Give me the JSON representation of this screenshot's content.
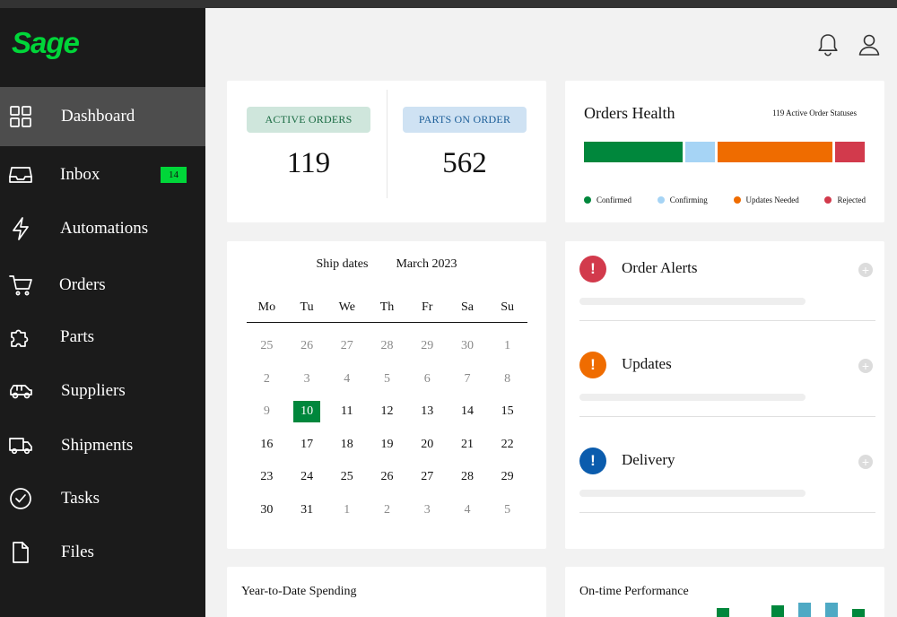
{
  "brand": {
    "name": "Sage",
    "color": "#00d639"
  },
  "nav": [
    {
      "label": "Dashboard",
      "icon": "grid-icon"
    },
    {
      "label": "Inbox",
      "icon": "inbox-icon",
      "badge": "14"
    },
    {
      "label": "Automations",
      "icon": "lightning-icon"
    },
    {
      "label": "Orders",
      "icon": "cart-icon"
    },
    {
      "label": "Parts",
      "icon": "puzzle-icon"
    },
    {
      "label": "Suppliers",
      "icon": "car-icon"
    },
    {
      "label": "Shipments",
      "icon": "truck-icon"
    },
    {
      "label": "Tasks",
      "icon": "check-circle-icon"
    },
    {
      "label": "Files",
      "icon": "file-icon"
    }
  ],
  "header": {
    "icons": [
      "bell-icon",
      "user-icon"
    ]
  },
  "stats": {
    "active_orders": {
      "label": "ACTIVE ORDERS",
      "value": "119",
      "bg": "#cfe6dc",
      "fg": "#1a6b43"
    },
    "parts_on_order": {
      "label": "PARTS ON ORDER",
      "value": "562",
      "bg": "#cfe2f3",
      "fg": "#1d5f99"
    }
  },
  "health": {
    "title": "Orders Health",
    "subtitle": "119 Active Order Statuses",
    "segments": [
      {
        "name": "Confirmed",
        "fraction": 0.355,
        "color": "#00873c"
      },
      {
        "name": "Confirming",
        "fraction": 0.108,
        "color": "#a6d4f5"
      },
      {
        "name": "Updates Needed",
        "fraction": 0.415,
        "color": "#ef6c00"
      },
      {
        "name": "Rejected",
        "fraction": 0.108,
        "color": "#d23a4c"
      }
    ]
  },
  "calendar": {
    "label": "Ship dates",
    "month": "March 2023",
    "days_of_week": [
      "Mo",
      "Tu",
      "We",
      "Th",
      "Fr",
      "Sa",
      "Su"
    ],
    "weeks": [
      [
        [
          "25",
          0
        ],
        [
          "26",
          0
        ],
        [
          "27",
          0
        ],
        [
          "28",
          0
        ],
        [
          "29",
          0
        ],
        [
          "30",
          0
        ],
        [
          "1",
          0
        ]
      ],
      [
        [
          "2",
          0
        ],
        [
          "3",
          0
        ],
        [
          "4",
          0
        ],
        [
          "5",
          0
        ],
        [
          "6",
          0
        ],
        [
          "7",
          0
        ],
        [
          "8",
          0
        ]
      ],
      [
        [
          "9",
          0
        ],
        [
          "10",
          2
        ],
        [
          "11",
          1
        ],
        [
          "12",
          1
        ],
        [
          "13",
          1
        ],
        [
          "14",
          1
        ],
        [
          "15",
          1
        ]
      ],
      [
        [
          "16",
          1
        ],
        [
          "17",
          1
        ],
        [
          "18",
          1
        ],
        [
          "19",
          1
        ],
        [
          "20",
          1
        ],
        [
          "21",
          1
        ],
        [
          "22",
          1
        ]
      ],
      [
        [
          "23",
          1
        ],
        [
          "24",
          1
        ],
        [
          "25",
          1
        ],
        [
          "26",
          1
        ],
        [
          "27",
          1
        ],
        [
          "28",
          1
        ],
        [
          "29",
          1
        ]
      ],
      [
        [
          "30",
          1
        ],
        [
          "31",
          1
        ],
        [
          "1",
          0
        ],
        [
          "2",
          0
        ],
        [
          "3",
          0
        ],
        [
          "4",
          0
        ],
        [
          "5",
          0
        ]
      ]
    ]
  },
  "alerts": [
    {
      "title": "Order Alerts",
      "icon": "exclamation-icon",
      "color": "#d23a4c"
    },
    {
      "title": "Updates",
      "icon": "exclamation-icon",
      "color": "#ef6c00"
    },
    {
      "title": "Delivery",
      "icon": "exclamation-icon",
      "color": "#0b5cad"
    }
  ],
  "bottom": {
    "spending_title": "Year-to-Date Spending",
    "performance_title": "On-time Performance"
  }
}
